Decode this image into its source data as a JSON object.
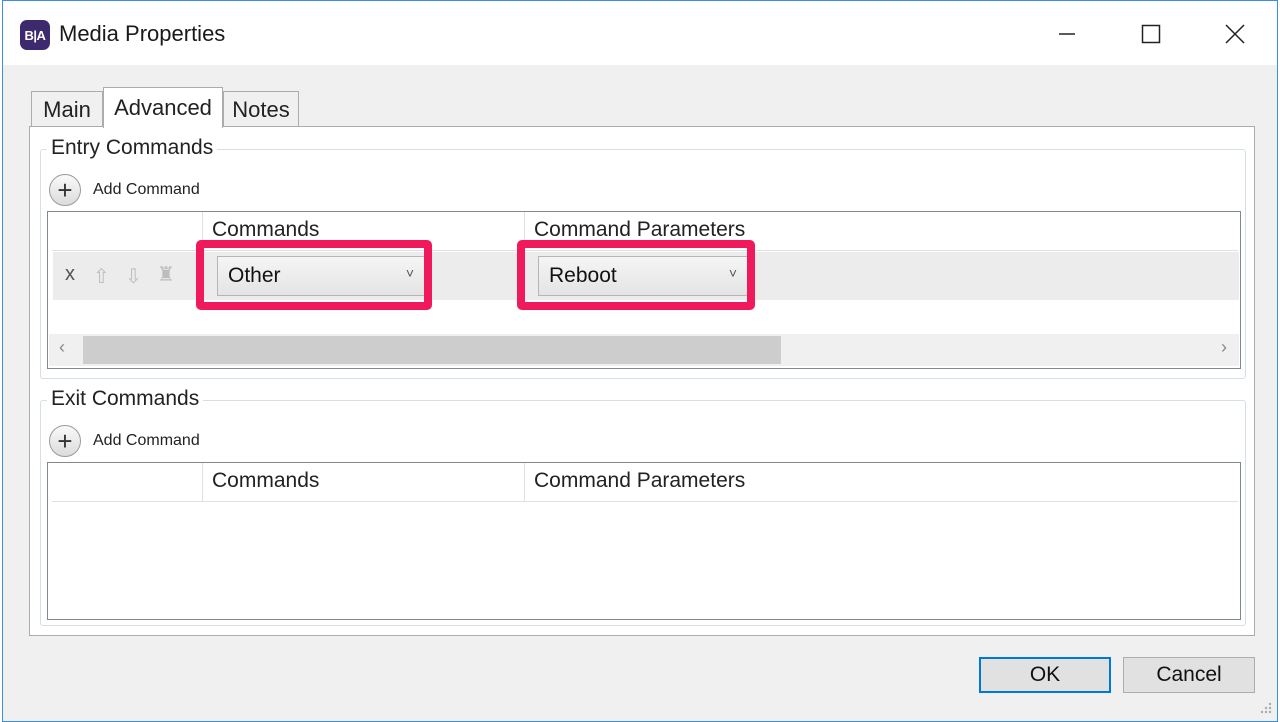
{
  "window": {
    "app_icon_text": "B|A",
    "title": "Media Properties"
  },
  "tabs": [
    {
      "label": "Main",
      "active": false
    },
    {
      "label": "Advanced",
      "active": true
    },
    {
      "label": "Notes",
      "active": false
    }
  ],
  "entry_commands": {
    "title": "Entry Commands",
    "add_label": "Add Command",
    "columns": [
      "Commands",
      "Command Parameters"
    ],
    "rows": [
      {
        "delete_label": "x",
        "command": "Other",
        "parameter": "Reboot"
      }
    ]
  },
  "exit_commands": {
    "title": "Exit Commands",
    "add_label": "Add Command",
    "columns": [
      "Commands",
      "Command Parameters"
    ],
    "rows": []
  },
  "footer": {
    "ok_label": "OK",
    "cancel_label": "Cancel"
  },
  "colors": {
    "highlight": "#f0195c",
    "primary_border": "#0078d7",
    "app_icon_bg": "#3d2a6e"
  }
}
